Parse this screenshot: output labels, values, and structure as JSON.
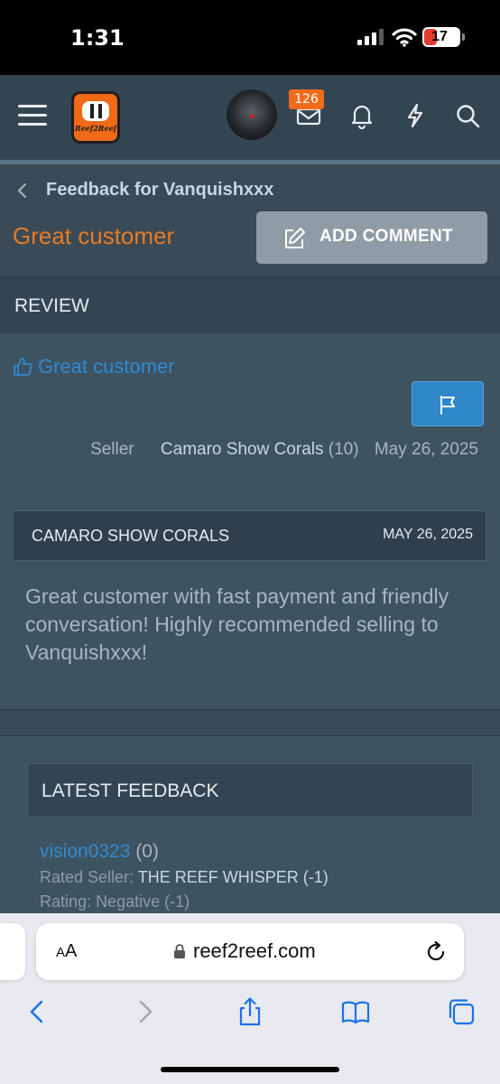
{
  "status_bar": {
    "time": "1:31",
    "battery": "17",
    "battery_level": 0.17
  },
  "navbar": {
    "logo_text": "Reef2Reef",
    "messages_badge": "126"
  },
  "breadcrumb": {
    "label": "Feedback for Vanquishxxx"
  },
  "page": {
    "title": "Great customer",
    "add_comment_label": "ADD COMMENT"
  },
  "review": {
    "section_label": "REVIEW",
    "headline": "Great customer",
    "role": "Seller",
    "seller_name": "Camaro Show Corals",
    "seller_count": "(10)",
    "date": "May 26, 2025"
  },
  "comment": {
    "author": "CAMARO SHOW CORALS",
    "date": "MAY 26, 2025",
    "body": "Great customer with fast payment and friendly conversation! Highly recommended selling to Vanquishxxx!"
  },
  "latest_feedback": {
    "header": "LATEST FEEDBACK",
    "user": "vision0323",
    "user_count": "(0)",
    "rated_label": "Rated Seller:",
    "rated_value": "THE REEF WHISPER (-1)",
    "rating_label": "Rating:",
    "rating_value": "Negative (-1)"
  },
  "browser": {
    "aa_small": "A",
    "aa_large": "A",
    "url": "reef2reef.com"
  },
  "colors": {
    "accent_orange": "#e87b23",
    "link_blue": "#2f8ad3",
    "nav_bg": "#344552",
    "badge_orange": "#f26b1d"
  }
}
